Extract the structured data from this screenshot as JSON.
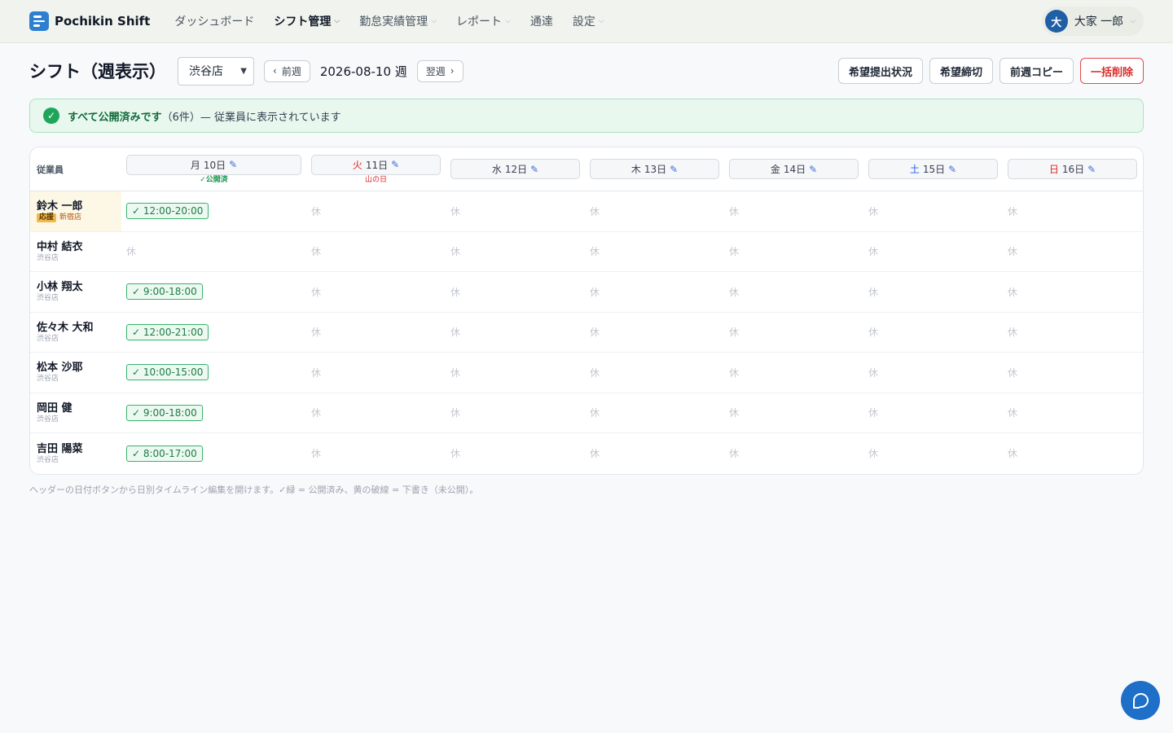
{
  "nav": {
    "brand": "Pochikin Shift",
    "items": [
      {
        "label": "ダッシュボード",
        "active": false,
        "dropdown": false
      },
      {
        "label": "シフト管理",
        "active": true,
        "dropdown": true
      },
      {
        "label": "勤怠実績管理",
        "active": false,
        "dropdown": true
      },
      {
        "label": "レポート",
        "active": false,
        "dropdown": true
      },
      {
        "label": "通達",
        "active": false,
        "dropdown": false
      },
      {
        "label": "設定",
        "active": false,
        "dropdown": true
      }
    ],
    "user": {
      "initial": "大",
      "name": "大家 一郎"
    }
  },
  "toolbar": {
    "title": "シフト（週表示）",
    "store": "渋谷店",
    "prev_label": "前週",
    "week_label": "2026-08-10 週",
    "next_label": "翌週",
    "actions": {
      "requests": "希望提出状況",
      "deadline": "希望締切",
      "copy": "前週コピー",
      "bulk_delete": "一括削除"
    }
  },
  "banner": {
    "strong": "すべて公開済みです",
    "rest": "（6件）— 従業員に表示されています"
  },
  "grid": {
    "employee_header": "従業員",
    "days": [
      {
        "weekday": "月",
        "date": "10日",
        "sub": "✓公開済"
      },
      {
        "weekday": "火",
        "date": "11日",
        "sub": "山の日"
      },
      {
        "weekday": "水",
        "date": "12日",
        "sub": ""
      },
      {
        "weekday": "木",
        "date": "13日",
        "sub": ""
      },
      {
        "weekday": "金",
        "date": "14日",
        "sub": ""
      },
      {
        "weekday": "土",
        "date": "15日",
        "sub": ""
      },
      {
        "weekday": "日",
        "date": "16日",
        "sub": ""
      }
    ],
    "off_label": "休",
    "rows": [
      {
        "name": "鈴木 一郎",
        "badge": "応援",
        "store": "新宿店",
        "cells": [
          "✓ 12:00-20:00",
          "休",
          "休",
          "休",
          "休",
          "休",
          "休"
        ]
      },
      {
        "name": "中村 結衣",
        "badge": "",
        "store": "渋谷店",
        "cells": [
          "休",
          "休",
          "休",
          "休",
          "休",
          "休",
          "休"
        ]
      },
      {
        "name": "小林 翔太",
        "badge": "",
        "store": "渋谷店",
        "cells": [
          "✓ 9:00-18:00",
          "休",
          "休",
          "休",
          "休",
          "休",
          "休"
        ]
      },
      {
        "name": "佐々木 大和",
        "badge": "",
        "store": "渋谷店",
        "cells": [
          "✓ 12:00-21:00",
          "休",
          "休",
          "休",
          "休",
          "休",
          "休"
        ]
      },
      {
        "name": "松本 沙耶",
        "badge": "",
        "store": "渋谷店",
        "cells": [
          "✓ 10:00-15:00",
          "休",
          "休",
          "休",
          "休",
          "休",
          "休"
        ]
      },
      {
        "name": "岡田 健",
        "badge": "",
        "store": "渋谷店",
        "cells": [
          "✓ 9:00-18:00",
          "休",
          "休",
          "休",
          "休",
          "休",
          "休"
        ]
      },
      {
        "name": "吉田 陽菜",
        "badge": "",
        "store": "渋谷店",
        "cells": [
          "✓ 8:00-17:00",
          "休",
          "休",
          "休",
          "休",
          "休",
          "休"
        ]
      }
    ]
  },
  "footnote": "ヘッダーの日付ボタンから日別タイムライン編集を開けます。✓緑 = 公開済み、黄の破線 = 下書き（未公開）。",
  "icons": {
    "pencil": "pencil-icon",
    "check": "check-circle-icon",
    "chat": "chat-icon",
    "chevron": "chevron-down-icon"
  },
  "colors": {
    "accent": "#2f7fd1",
    "published": "#39b36c",
    "danger": "#d92d2d",
    "holiday": "#dc2626",
    "saturday": "#2563eb"
  }
}
